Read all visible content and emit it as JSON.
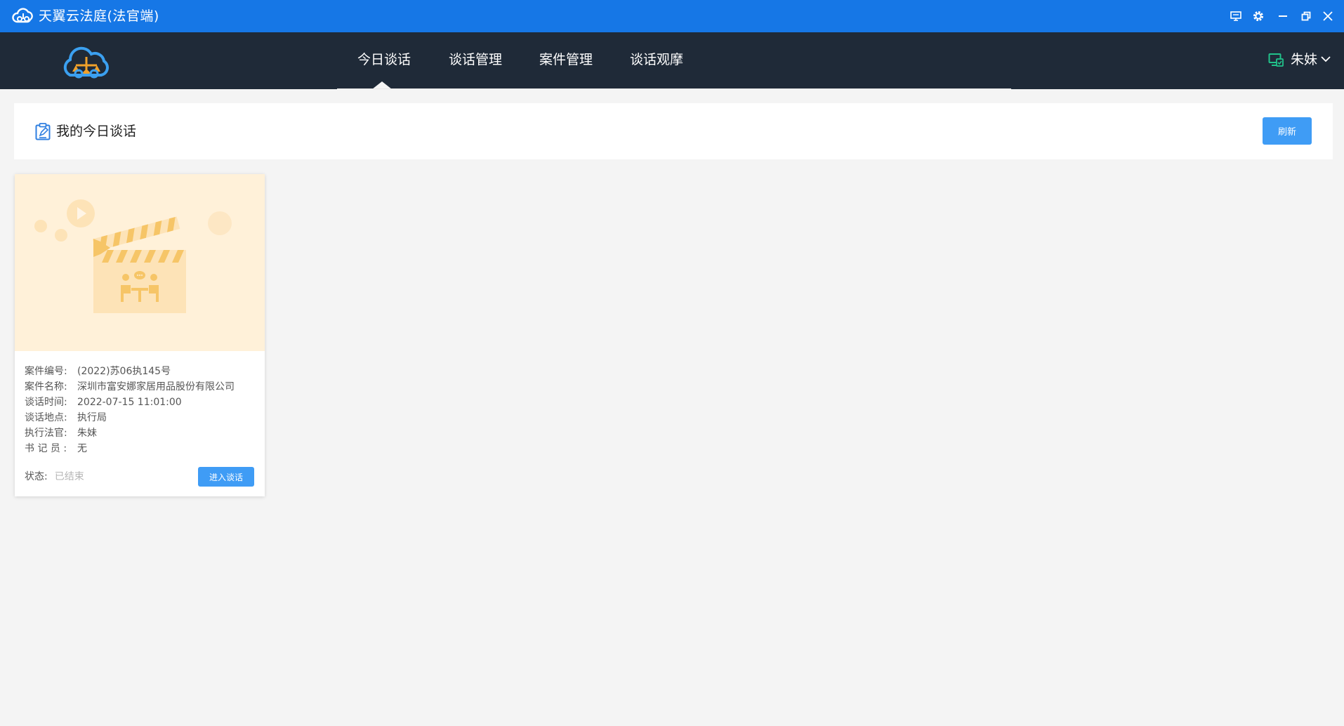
{
  "window": {
    "title": "天翼云法庭(法官端)",
    "controls": [
      {
        "name": "monitor-icon"
      },
      {
        "name": "gear-icon"
      },
      {
        "name": "minimize-icon"
      },
      {
        "name": "restore-icon"
      },
      {
        "name": "close-icon"
      }
    ]
  },
  "nav": {
    "items": [
      {
        "label": "今日谈话",
        "active": true
      },
      {
        "label": "谈话管理",
        "active": false
      },
      {
        "label": "案件管理",
        "active": false
      },
      {
        "label": "谈话观摩",
        "active": false
      }
    ],
    "user": {
      "name": "朱妹",
      "icon": "device-check-icon"
    }
  },
  "header": {
    "title": "我的今日谈话",
    "icon": "clipboard-edit-icon",
    "refresh_label": "刷新"
  },
  "sessions": [
    {
      "case_no_label": "案件编号:",
      "case_no": "(2022)苏06执145号",
      "case_name_label": "案件名称:",
      "case_name": "深圳市富安娜家居用品股份有限公司",
      "time_label": "谈话时间:",
      "time": "2022-07-15 11:01:00",
      "place_label": "谈话地点:",
      "place": "执行局",
      "judge_label": "执行法官:",
      "judge": "朱妹",
      "clerk_label": "书 记 员 :",
      "clerk": "无",
      "status_label": "状态:",
      "status": "已结束",
      "enter_label": "进入谈话",
      "thumbnail": "clapperboard-illustration"
    }
  ],
  "colors": {
    "titlebar": "#1677e6",
    "navbar": "#1f2a38",
    "accent": "#3f9cf5",
    "thumb_bg": "#fff1d9"
  }
}
